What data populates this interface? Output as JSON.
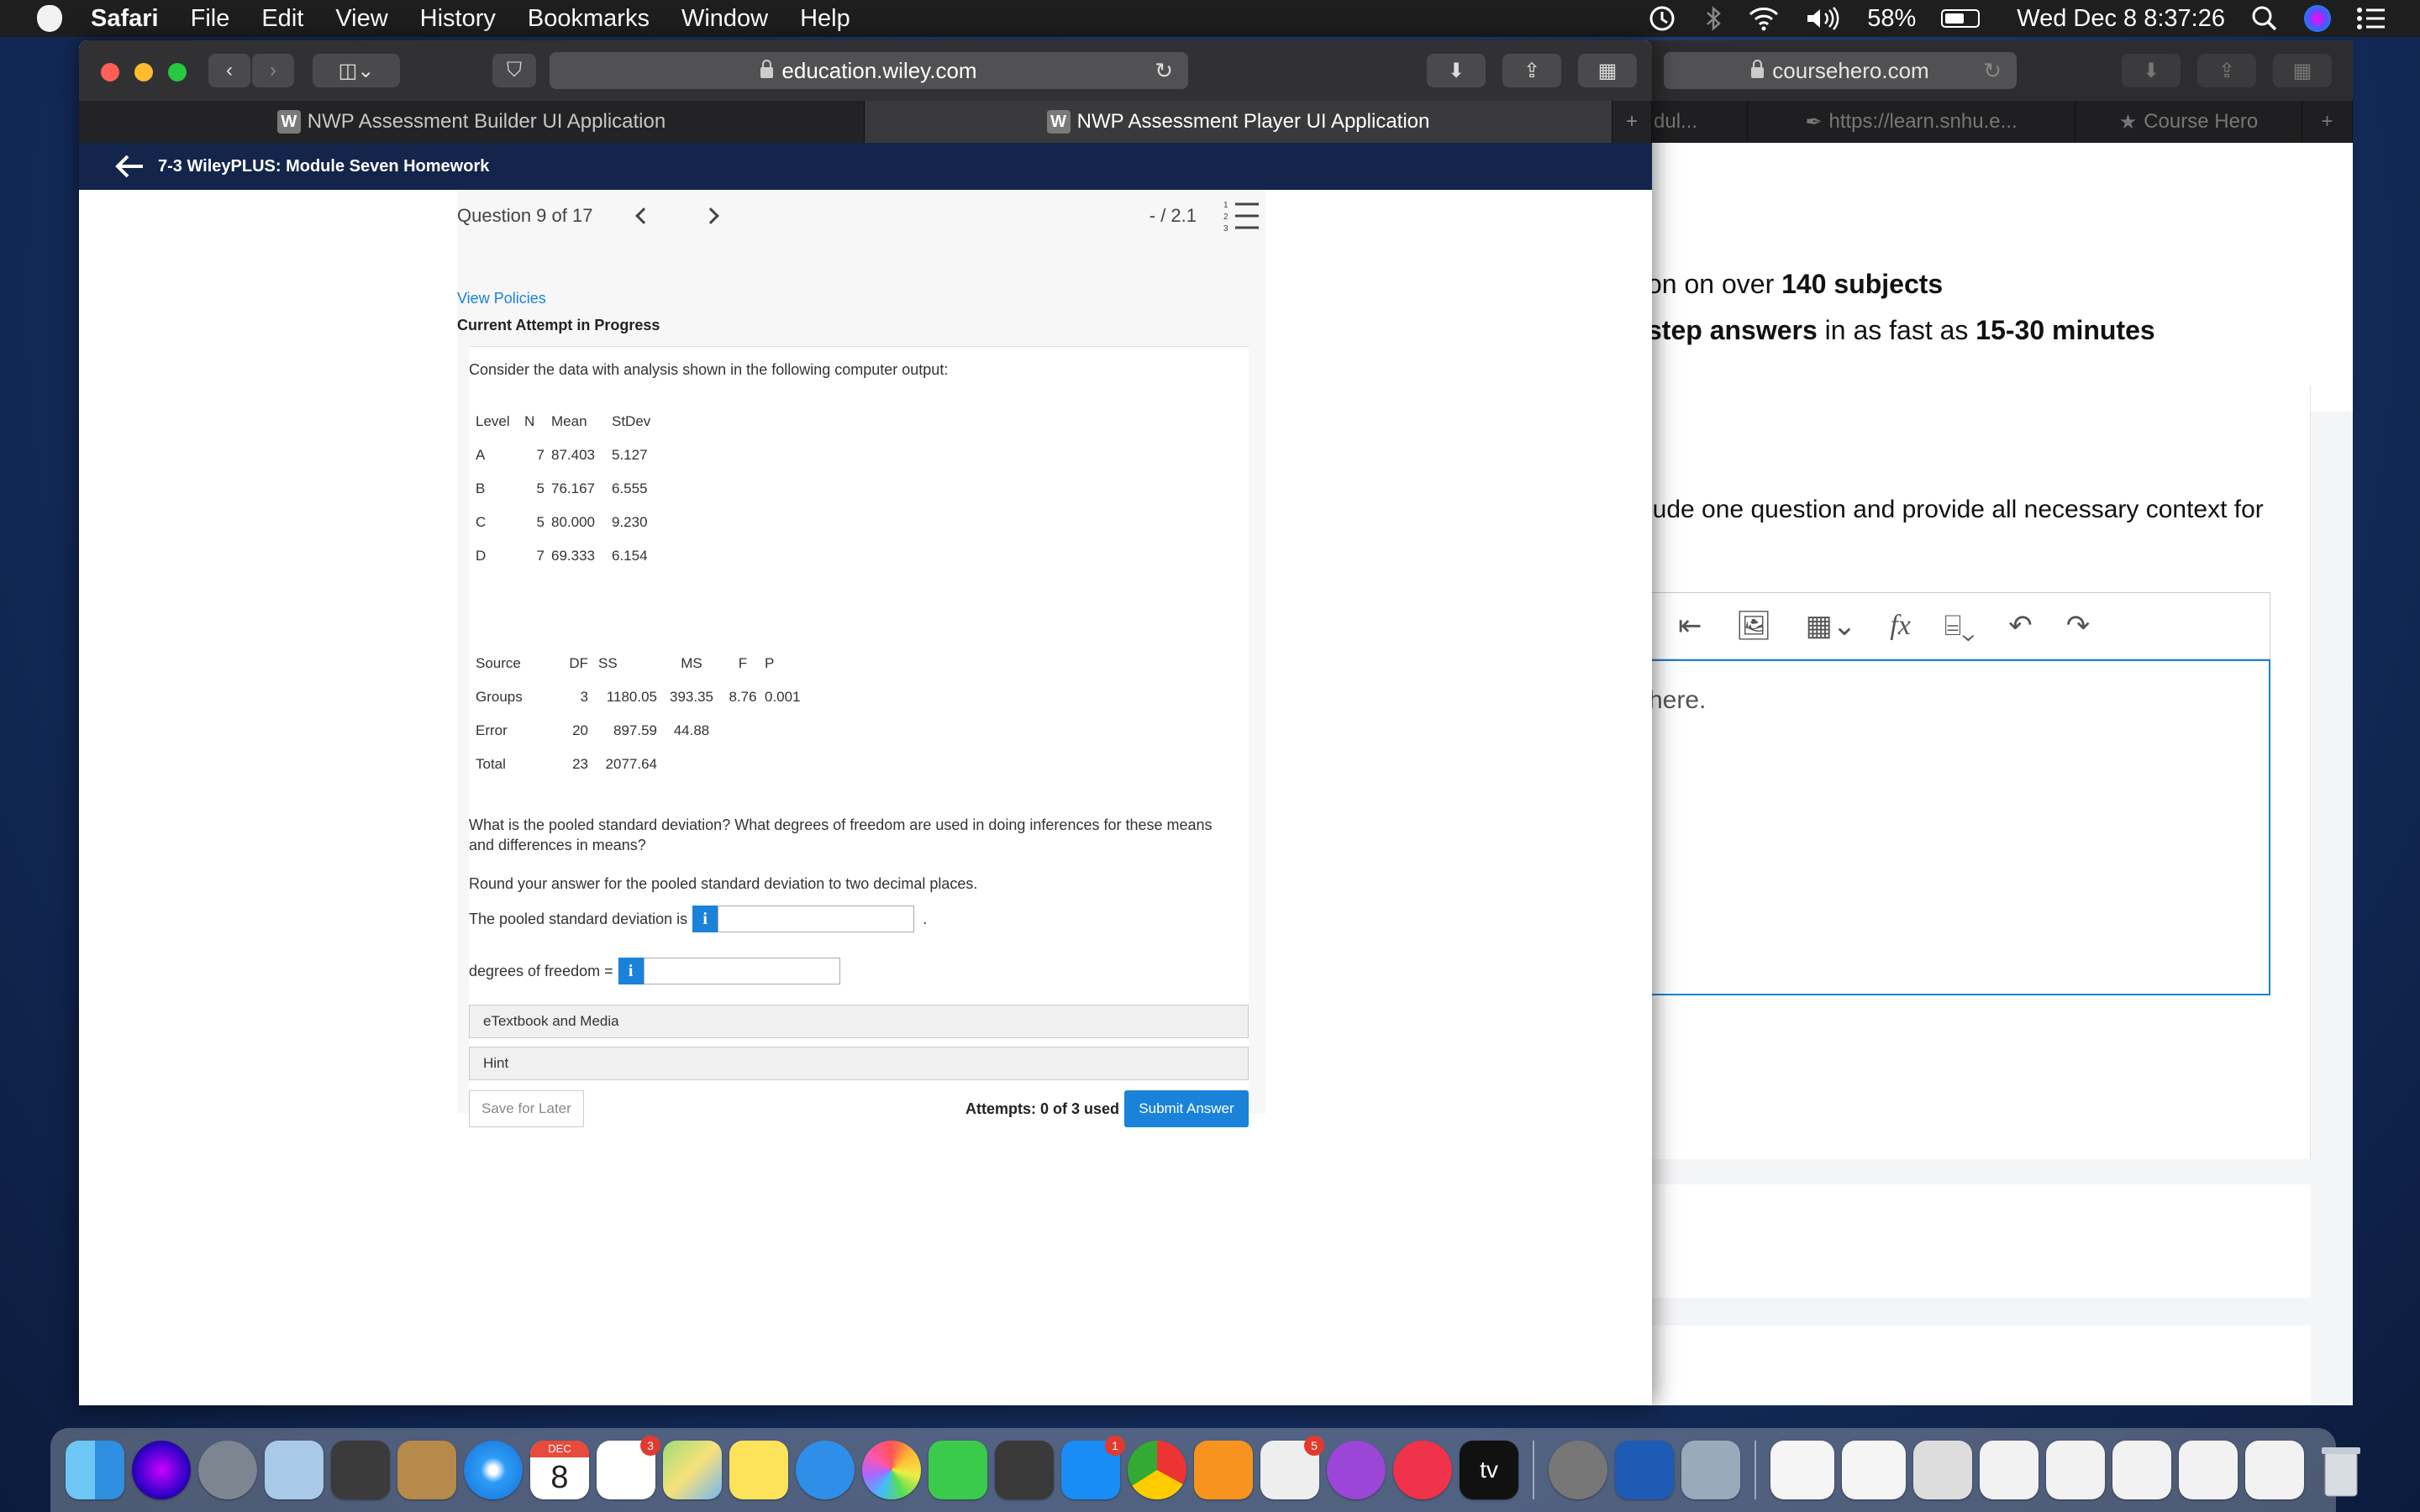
{
  "menubar": {
    "app": "Safari",
    "items": [
      "File",
      "Edit",
      "View",
      "History",
      "Bookmarks",
      "Window",
      "Help"
    ],
    "battery": "58%",
    "clock": "Wed Dec 8  8:37:26"
  },
  "safari_left": {
    "url": "education.wiley.com",
    "tabs": [
      {
        "badge": "W",
        "label": "NWP Assessment Builder UI Application"
      },
      {
        "badge": "W",
        "label": "NWP Assessment Player UI Application"
      }
    ],
    "nav_title": "7-3 WileyPLUS: Module Seven Homework"
  },
  "question": {
    "counter": "Question 9 of 17",
    "score": "- / 2.1",
    "view_policies": "View Policies",
    "attempt_status": "Current Attempt in Progress",
    "intro": "Consider the data with analysis shown in the following computer output:",
    "table1": {
      "headers": [
        "Level",
        "N",
        "Mean",
        "StDev"
      ],
      "rows": [
        [
          "A",
          "7",
          "87.403",
          "5.127"
        ],
        [
          "B",
          "5",
          "76.167",
          "6.555"
        ],
        [
          "C",
          "5",
          "80.000",
          "9.230"
        ],
        [
          "D",
          "7",
          "69.333",
          "6.154"
        ]
      ]
    },
    "table2": {
      "headers": [
        "Source",
        "DF",
        "SS",
        "MS",
        "F",
        "P"
      ],
      "rows": [
        [
          "Groups",
          "3",
          "1180.05",
          "393.35",
          "8.76",
          "0.001"
        ],
        [
          "Error",
          "20",
          "897.59",
          "44.88",
          "",
          ""
        ],
        [
          "Total",
          "23",
          "2077.64",
          "",
          "",
          ""
        ]
      ]
    },
    "prompt": "What is the pooled standard deviation? What degrees of freedom are used in doing inferences for these means and differences in means?",
    "rounding": "Round your answer for the pooled standard deviation to two decimal places.",
    "pooled_label": "The pooled standard deviation is",
    "pooled_suffix": ".",
    "df_label": "degrees of freedom =",
    "info_glyph": "i",
    "etextbook": "eTextbook and Media",
    "hint": "Hint",
    "save_later": "Save for Later",
    "attempts": "Attempts: 0 of 3 used",
    "submit": "Submit Answer"
  },
  "safari_right": {
    "url": "coursehero.com",
    "tabs": [
      "dul...",
      "https://learn.snhu.e...",
      "Course Hero"
    ],
    "line1_pre": "on on over ",
    "line1_bold": "140 subjects",
    "line2_bold": "step answers",
    "line2_mid": " in as fast as ",
    "line2_bold2": "15-30 minutes",
    "context_text": "lude one question and provide all necessary context for",
    "editor_placeholder": "here."
  },
  "dock": {
    "calendar_month": "DEC",
    "calendar_day": "8",
    "badges": {
      "reminders": "3",
      "appstore": "1",
      "settings": "5"
    },
    "tv_label": "tv"
  },
  "colors": {
    "accent": "#1a82d9",
    "nav": "#13254a",
    "link": "#1a82d9"
  }
}
